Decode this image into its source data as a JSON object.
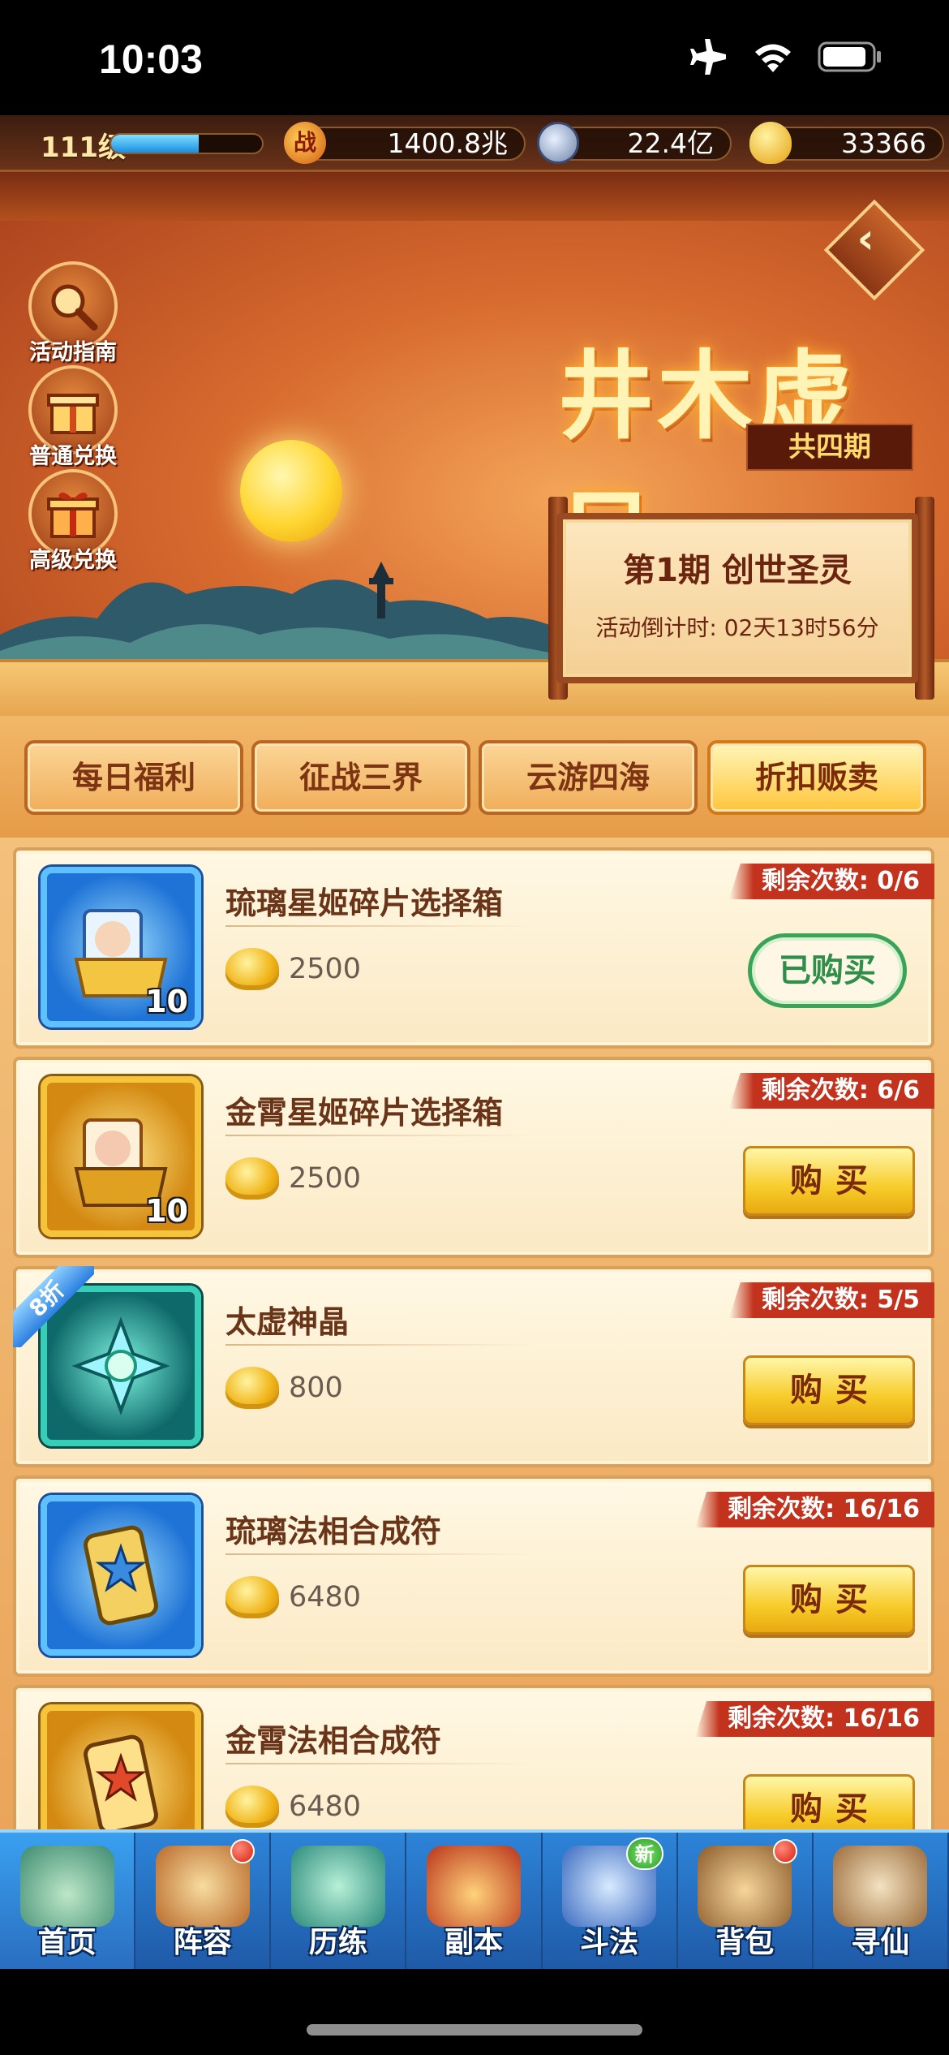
{
  "status_bar": {
    "time": "10:03"
  },
  "resources": {
    "level": "111级",
    "xp_fraction": 0.58,
    "power_icon_glyph": "战",
    "power": "1400.8兆",
    "silver": "22.4亿",
    "gold": "33366"
  },
  "banner": {
    "title": "井木虚日",
    "subtitle": "共四期",
    "period": "第1期  创世圣灵",
    "countdown": "活动倒计时: 02天13时56分",
    "back_glyph": "‹",
    "side_buttons": [
      {
        "label": "活动指南",
        "icon": "magnifier-icon"
      },
      {
        "label": "普通兑换",
        "icon": "gift-box-icon"
      },
      {
        "label": "高级兑换",
        "icon": "gift-box-icon"
      }
    ]
  },
  "tabs": [
    {
      "label": "每日福利",
      "active": false
    },
    {
      "label": "征战三界",
      "active": false
    },
    {
      "label": "云游四海",
      "active": false
    },
    {
      "label": "折扣贩卖",
      "active": true
    }
  ],
  "shop_items": [
    {
      "name": "琉璃星姬碎片选择箱",
      "price": "2500",
      "remaining": "剩余次数: 0/6",
      "quantity": "10",
      "button": "已购买",
      "bought": true
    },
    {
      "name": "金霄星姬碎片选择箱",
      "price": "2500",
      "remaining": "剩余次数: 6/6",
      "quantity": "10",
      "button": "购买",
      "bought": false
    },
    {
      "name": "太虚神晶",
      "price": "800",
      "remaining": "剩余次数: 5/5",
      "discount": "8折",
      "button": "购买",
      "bought": false
    },
    {
      "name": "琉璃法相合成符",
      "price": "6480",
      "remaining": "剩余次数: 16/16",
      "button": "购买",
      "bought": false
    },
    {
      "name": "金霄法相合成符",
      "price": "6480",
      "remaining": "剩余次数: 16/16",
      "button": "购买",
      "bought": false
    }
  ],
  "bottom_nav": [
    {
      "label": "首页",
      "badge": ""
    },
    {
      "label": "阵容",
      "badge": "dot"
    },
    {
      "label": "历练",
      "badge": ""
    },
    {
      "label": "副本",
      "badge": ""
    },
    {
      "label": "斗法",
      "badge": "新"
    },
    {
      "label": "背包",
      "badge": "dot"
    },
    {
      "label": "寻仙",
      "badge": ""
    }
  ],
  "colors": {
    "accent_gold": "#f7cc2a",
    "remaining_tag": "#c2321c",
    "bought_green": "#3aa35a",
    "nav_blue": "#2d84d8"
  }
}
